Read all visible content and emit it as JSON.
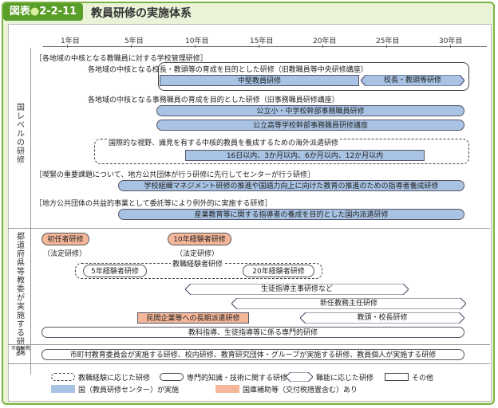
{
  "figure": {
    "label_prefix": "図表",
    "label_dot": "●",
    "label_num": "2-2-11",
    "title": "教員研修の実施体系"
  },
  "years": [
    "1年目",
    "5年目",
    "10年目",
    "15年目",
    "20年目",
    "25年目",
    "30年目"
  ],
  "sections": {
    "national": "国レベルの研修",
    "prefectural": "都道府県等教委が実施する研修",
    "municipal": "市町村教委等"
  },
  "national": {
    "group1_title": "［各地域の中核となる教職員に対する学校管理研修］",
    "group1_sub1": "各地域の中核となる校長・教頭等の育成を目的とした研修（旧教職員等中央研修講座）",
    "bar_chuken": "中堅教員研修",
    "bar_kocho": "校長・教頭等研修",
    "group1_sub2": "各地域の中核となる事務職員の育成を目的とした研修（旧事務職員研修講座）",
    "bar_jimu1": "公立小・中学校幹部事務職員研修",
    "bar_jimu2": "公立高等学校幹部事務職員研修講座",
    "overseas_title": "国際的な視野、識見を有する中核的教員を養成するための海外派遣研修",
    "bar_overseas": "16日以内、3か月以内、6か月以内、12か月以内",
    "group2_title": "［喫緊の重要課題について、地方公共団体が行う研修に先行してセンターが行う研修］",
    "bar_management": "学校組織マネジメント研修の推進や国語力向上に向けた教育の推進のための指導者養成研修",
    "group3_title": "［地方公共団体の共益的事業として委託等により例外的に実施する研修］",
    "bar_industry": "産業教育等に関する指導者の養成を目的とした国内派遣研修"
  },
  "prefectural": {
    "shoninsha": "初任者研修",
    "shoninsha_law": "（法定研修）",
    "ten_year": "10年経験者研修",
    "ten_year_law": "（法定研修）",
    "experience_label": "教職経験者研修",
    "five_year": "5年経験者研修",
    "twenty_year": "20年経験者研修",
    "student_guidance": "生徒指導主事研修など",
    "new_head": "新任教務主任研修",
    "principal": "教頭・校長研修",
    "long_term": "民間企業等への長期派遣研修",
    "specialist": "教科指導、生徒指導等に係る専門的研修"
  },
  "municipal": {
    "text": "市町村教育委員会が実施する研修、校内研修、教育研究団体・グループが実施する研修、教員個人が実施する研修"
  },
  "legend": {
    "experience": "教職経験に応じた研修",
    "specialist": "専門的知識・技術に関する研修",
    "role": "職能に応じた研修",
    "other": "その他",
    "national": "国（教員研修センター）が実施",
    "subsidy": "国庫補助等（交付税措置含む）あり"
  },
  "colors": {
    "frame": "#7cb342",
    "national_bar": "#a9c3e4",
    "subsidy": "#f5b79a"
  }
}
